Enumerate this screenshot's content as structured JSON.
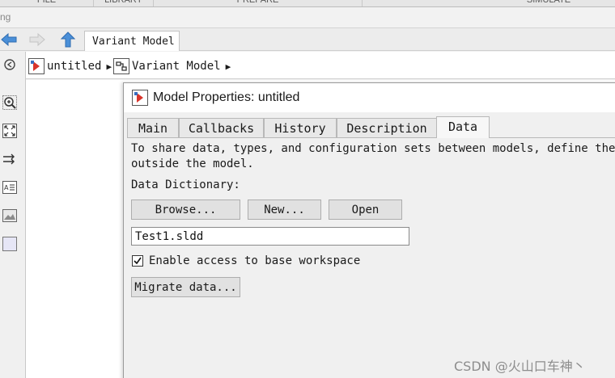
{
  "ribbon": {
    "tabs": [
      "FILE",
      "LIBRARY",
      "PREPARE",
      "SIMULATE"
    ],
    "cut_label": "ng"
  },
  "nav": {
    "doc_tab": "Variant Model"
  },
  "breadcrumb": {
    "items": [
      "untitled",
      "Variant Model"
    ]
  },
  "dialog": {
    "title": "Model Properties: untitled",
    "tabs": [
      "Main",
      "Callbacks",
      "History",
      "Description",
      "Data"
    ],
    "active_tab": "Data",
    "description_line1": "To share data, types, and configuration sets between models, define them",
    "description_line2": "outside the model.",
    "data_dictionary_label": "Data Dictionary:",
    "buttons": {
      "browse": "Browse...",
      "new": "New...",
      "open": "Open"
    },
    "dictionary_value": "Test1.sldd",
    "base_workspace_label": "Enable access to base workspace",
    "base_workspace_checked": true,
    "migrate_button": "Migrate data..."
  },
  "watermark": "CSDN @火山口车神丶"
}
